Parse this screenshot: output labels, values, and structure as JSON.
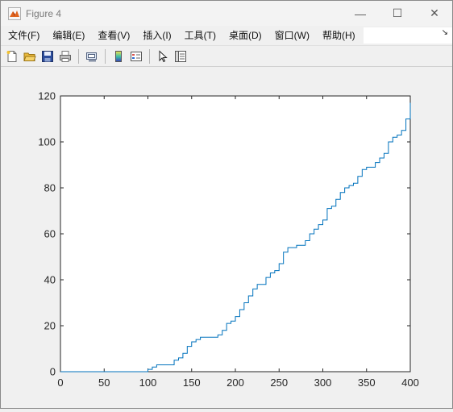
{
  "window": {
    "title": "Figure 4",
    "controls": {
      "minimize": "—",
      "maximize": "☐",
      "close": "✕"
    }
  },
  "menu": {
    "items": [
      "文件(F)",
      "编辑(E)",
      "查看(V)",
      "插入(I)",
      "工具(T)",
      "桌面(D)",
      "窗口(W)",
      "帮助(H)"
    ],
    "overflow_glyph": "↘"
  },
  "toolbar": {
    "icons": [
      "new-figure-icon",
      "open-icon",
      "save-icon",
      "print-icon",
      "link-icon",
      "colorbar-icon",
      "legend-icon",
      "pointer-icon",
      "property-inspector-icon"
    ]
  },
  "colors": {
    "line": "#0072bd",
    "axes_bg": "#ffffff",
    "figure_bg": "#f0f0f0"
  },
  "chart_data": {
    "type": "line",
    "title": "",
    "xlabel": "",
    "ylabel": "",
    "xlim": [
      0,
      400
    ],
    "ylim": [
      0,
      120
    ],
    "xticks": [
      0,
      50,
      100,
      150,
      200,
      250,
      300,
      350,
      400
    ],
    "yticks": [
      0,
      20,
      40,
      60,
      80,
      100,
      120
    ],
    "grid": false,
    "legend": "none",
    "series": [
      {
        "x": [
          0,
          98,
          100,
          105,
          110,
          125,
          130,
          135,
          140,
          145,
          150,
          155,
          160,
          170,
          180,
          185,
          190,
          195,
          200,
          205,
          210,
          215,
          220,
          225,
          230,
          235,
          240,
          245,
          250,
          255,
          260,
          265,
          270,
          275,
          280,
          285,
          290,
          295,
          300,
          305,
          310,
          315,
          320,
          325,
          330,
          335,
          340,
          345,
          350,
          355,
          360,
          365,
          370,
          375,
          380,
          385,
          390,
          395,
          400
        ],
        "y": [
          0,
          0,
          1,
          2,
          3,
          3,
          5,
          6,
          8,
          11,
          13,
          14,
          15,
          15,
          16,
          18,
          21,
          22,
          24,
          27,
          30,
          33,
          36,
          38,
          38,
          41,
          43,
          44,
          47,
          52,
          54,
          54,
          55,
          55,
          57,
          60,
          62,
          64,
          66,
          71,
          72,
          75,
          78,
          80,
          81,
          82,
          85,
          88,
          89,
          89,
          91,
          93,
          95,
          100,
          102,
          103,
          105,
          110,
          117
        ]
      }
    ]
  }
}
